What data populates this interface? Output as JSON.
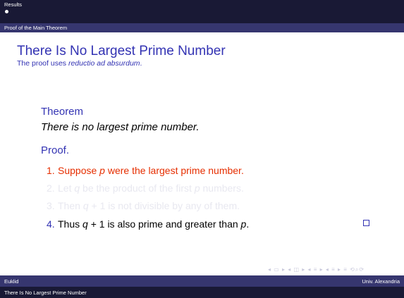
{
  "header": {
    "section": "Results",
    "subsection": "Proof of the Main Theorem"
  },
  "frame": {
    "title": "There Is No Largest Prime Number",
    "subtitle_prefix": "The proof uses ",
    "subtitle_emph": "reductio ad absurdum",
    "subtitle_suffix": "."
  },
  "theorem": {
    "heading": "Theorem",
    "statement": "There is no largest prime number."
  },
  "proof": {
    "heading": "Proof.",
    "steps": [
      {
        "num": "1.",
        "text_a": "Suppose ",
        "var1": "p",
        "text_b": " were the largest prime number.",
        "var2": "",
        "text_c": "",
        "color": "#e62e00"
      },
      {
        "num": "2.",
        "text_a": "Let ",
        "var1": "q",
        "text_b": " be the product of the first ",
        "var2": "p",
        "text_c": " numbers.",
        "color": "#e8e8f0"
      },
      {
        "num": "3.",
        "text_a": "Then ",
        "var1": "q",
        "text_b": " + 1 is not divisible by any of them.",
        "var2": "",
        "text_c": "",
        "color": "#e8e8f0"
      },
      {
        "num": "4.",
        "text_a": "Thus ",
        "var1": "q",
        "text_b": " + 1 is also prime and greater than ",
        "var2": "p",
        "text_c": ".",
        "color": "#000000"
      }
    ]
  },
  "navigation": {
    "symbols": "◂ ▭ ▸ ◂ ◫ ▸ ◂ ≡ ▸ ◂ ≡ ▸  ≡  ⟲⌕⟳"
  },
  "footer": {
    "author": "Euklid",
    "institute": "Univ. Alexandria",
    "title": "There Is No Largest Prime Number"
  },
  "colors": {
    "header_dark": "#191935",
    "header_light": "#36366f",
    "structure_blue": "#3333b3",
    "alert_red": "#e62e00",
    "faded": "#e8e8f0"
  }
}
